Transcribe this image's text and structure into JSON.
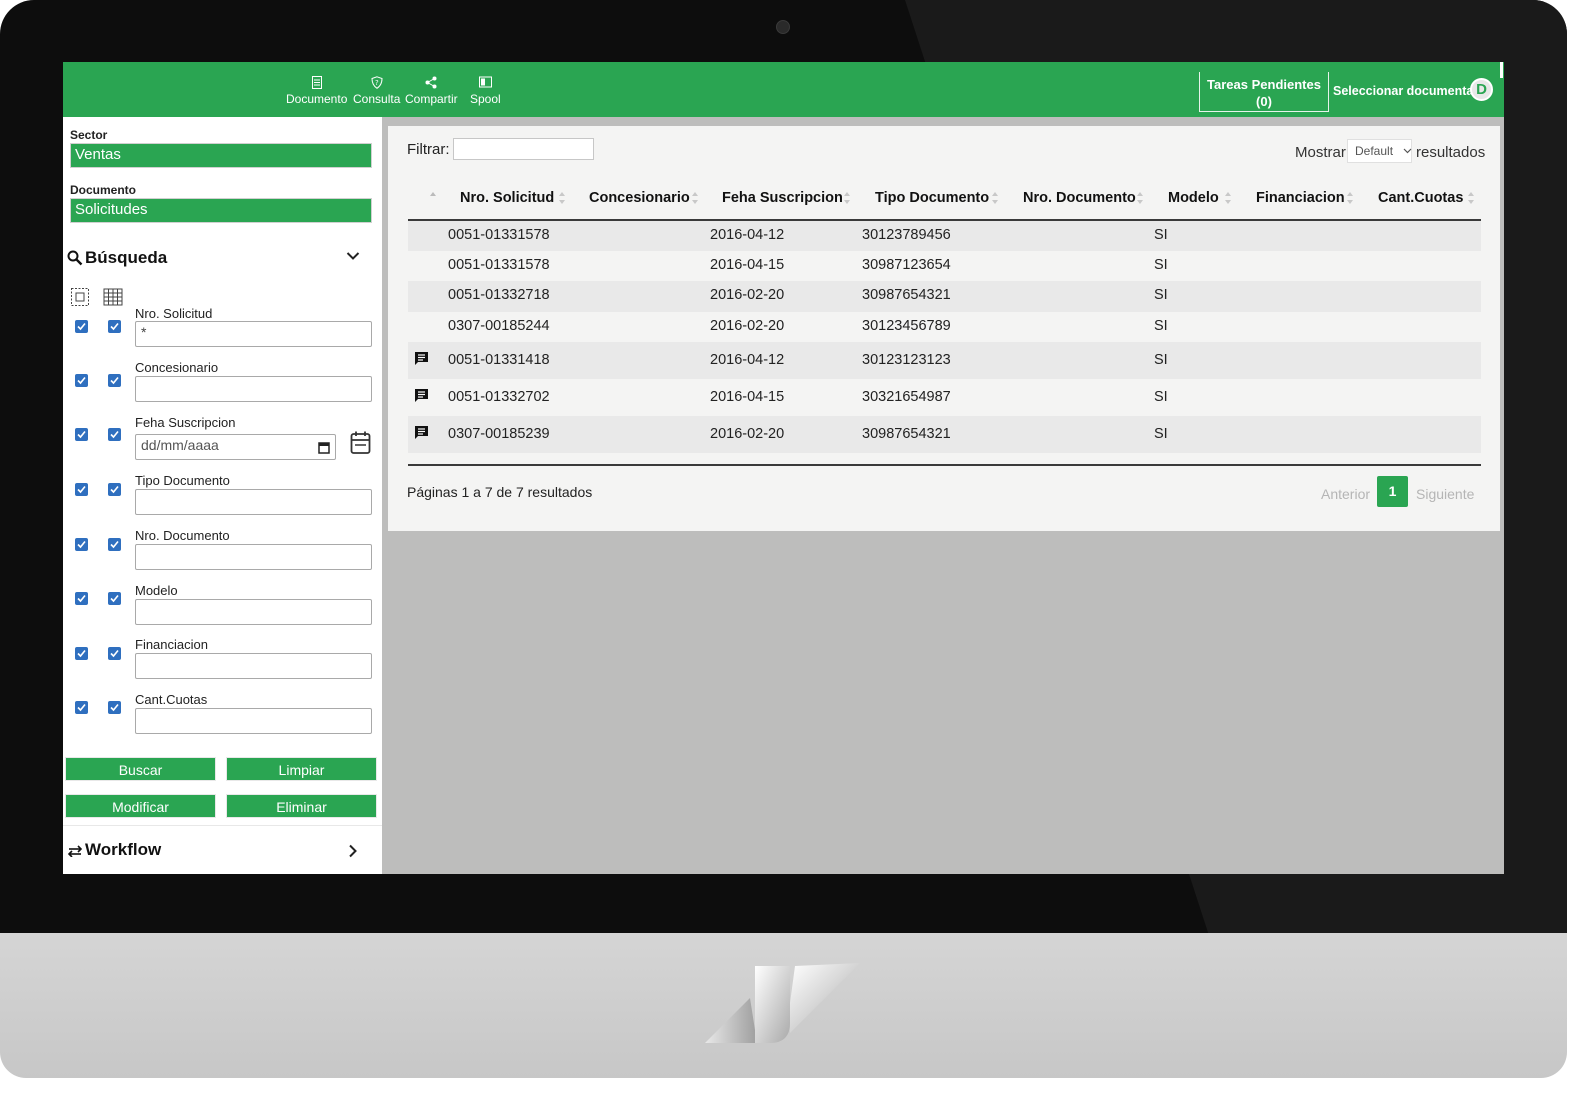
{
  "toolbar": {
    "items": [
      {
        "label": "Documento",
        "icon": "document-icon"
      },
      {
        "label": "Consulta",
        "icon": "shield-icon"
      },
      {
        "label": "Compartir",
        "icon": "share-icon"
      },
      {
        "label": "Spool",
        "icon": "spool-icon"
      }
    ],
    "tareas_label": "Tareas Pendientes",
    "tareas_count": "(0)",
    "select_doc": "Seleccionar documental",
    "avatar_letter": "D"
  },
  "sidebar": {
    "sector_label": "Sector",
    "sector_value": "Ventas",
    "documento_label": "Documento",
    "documento_value": "Solicitudes",
    "busqueda_title": "Búsqueda",
    "fields": [
      {
        "label": "Nro. Solicitud",
        "value": "*"
      },
      {
        "label": "Concesionario",
        "value": ""
      },
      {
        "label": "Feha Suscripcion",
        "placeholder": "dd/mm/aaaa"
      },
      {
        "label": "Tipo Documento",
        "value": ""
      },
      {
        "label": "Nro. Documento",
        "value": ""
      },
      {
        "label": "Modelo",
        "value": ""
      },
      {
        "label": "Financiacion",
        "value": ""
      },
      {
        "label": "Cant.Cuotas",
        "value": ""
      }
    ],
    "buttons": {
      "buscar": "Buscar",
      "limpiar": "Limpiar",
      "modificar": "Modificar",
      "eliminar": "Eliminar"
    },
    "workflow_title": "Workflow"
  },
  "panel": {
    "filtrar_label": "Filtrar:",
    "mostrar_label": "Mostrar",
    "mostrar_value": "Default",
    "resultados_label": "resultados",
    "columns": [
      "Nro. Solicitud",
      "Concesionario",
      "Feha Suscripcion",
      "Tipo Documento",
      "Nro. Documento",
      "Modelo",
      "Financiacion",
      "Cant.Cuotas"
    ],
    "rows": [
      {
        "nro": "0051-01331578",
        "fecha": "2016-04-12",
        "tipo": "30123789456",
        "modelo": "SI",
        "comment": false
      },
      {
        "nro": "0051-01331578",
        "fecha": "2016-04-15",
        "tipo": "30987123654",
        "modelo": "SI",
        "comment": false
      },
      {
        "nro": "0051-01332718",
        "fecha": "2016-02-20",
        "tipo": "30987654321",
        "modelo": "SI",
        "comment": false
      },
      {
        "nro": "0307-00185244",
        "fecha": "2016-02-20",
        "tipo": "30123456789",
        "modelo": "SI",
        "comment": false
      },
      {
        "nro": "0051-01331418",
        "fecha": "2016-04-12",
        "tipo": "30123123123",
        "modelo": "SI",
        "comment": true
      },
      {
        "nro": "0051-01332702",
        "fecha": "2016-04-15",
        "tipo": "30321654987",
        "modelo": "SI",
        "comment": true
      },
      {
        "nro": "0307-00185239",
        "fecha": "2016-02-20",
        "tipo": "30987654321",
        "modelo": "SI",
        "comment": true
      }
    ],
    "pages_info": "Páginas 1 a 7 de 7 resultados",
    "prev": "Anterior",
    "current_page": "1",
    "next": "Siguiente"
  },
  "colors": {
    "accent": "#2aa552",
    "checkbox": "#2f6fbf",
    "panel_bg": "#f4f4f3",
    "screen_bg": "#bdbdbc"
  }
}
